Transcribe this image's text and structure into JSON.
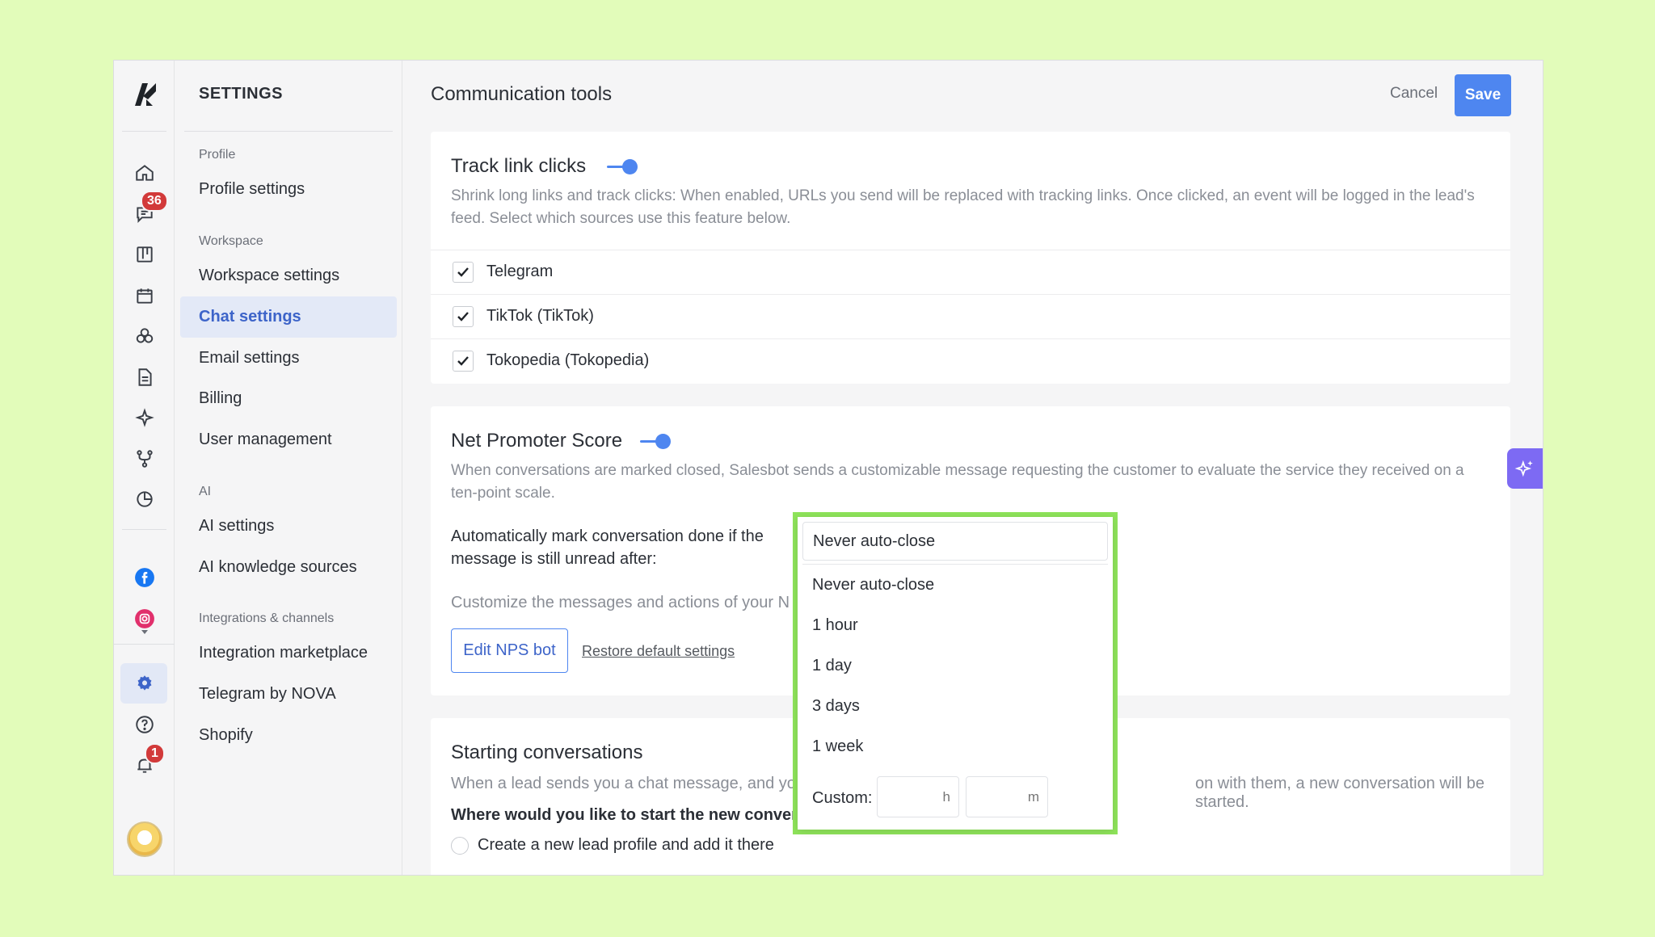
{
  "nav": {
    "title": "SETTINGS",
    "groups": {
      "profile": "Profile",
      "workspace": "Workspace",
      "ai": "AI",
      "integrations": "Integrations & channels"
    },
    "items": {
      "profile_settings": "Profile settings",
      "workspace_settings": "Workspace settings",
      "chat_settings": "Chat settings",
      "email_settings": "Email settings",
      "billing": "Billing",
      "user_management": "User management",
      "ai_settings": "AI settings",
      "ai_knowledge": "AI knowledge sources",
      "integration_marketplace": "Integration marketplace",
      "telegram_nova": "Telegram by NOVA",
      "shopify": "Shopify"
    }
  },
  "rail": {
    "chat_badge": "36",
    "notification_badge": "1",
    "colors": {
      "accent": "#4e86f0",
      "badge": "#d23a3a"
    }
  },
  "header": {
    "title": "Communication tools",
    "cancel_label": "Cancel",
    "save_label": "Save"
  },
  "track_links": {
    "title": "Track link clicks",
    "enabled": true,
    "description": "Shrink long links and track clicks: When enabled, URLs you send will be replaced with tracking links. Once clicked, an event will be logged in the lead's feed. Select which sources use this feature below.",
    "sources": [
      {
        "label": "Telegram",
        "checked": true
      },
      {
        "label": "TikTok (TikTok)",
        "checked": true
      },
      {
        "label": "Tokopedia (Tokopedia)",
        "checked": true
      }
    ]
  },
  "nps": {
    "title": "Net Promoter Score",
    "enabled": true,
    "description": "When conversations are marked closed, Salesbot sends a customizable message requesting the customer to evaluate the service they received on a ten-point scale.",
    "auto_mark_label": "Automatically mark conversation done if the message is still unread after:",
    "customize_text": "Customize the messages and actions of your N",
    "edit_button": "Edit NPS bot",
    "restore_link": "Restore default settings"
  },
  "starting": {
    "title": "Starting conversations",
    "description_start": "When a lead sends you a chat message, and yo",
    "description_end": "on with them, a new conversation will be started.",
    "question": "Where would you like to start the new convers",
    "option1": "Create a new lead profile and add it there"
  },
  "dropdown": {
    "selected": "Never auto-close",
    "options": [
      "Never auto-close",
      "1 hour",
      "1 day",
      "3 days",
      "1 week"
    ],
    "custom_label": "Custom:",
    "hours_placeholder": "h",
    "minutes_placeholder": "m",
    "highlight_color": "#8ee35a"
  }
}
